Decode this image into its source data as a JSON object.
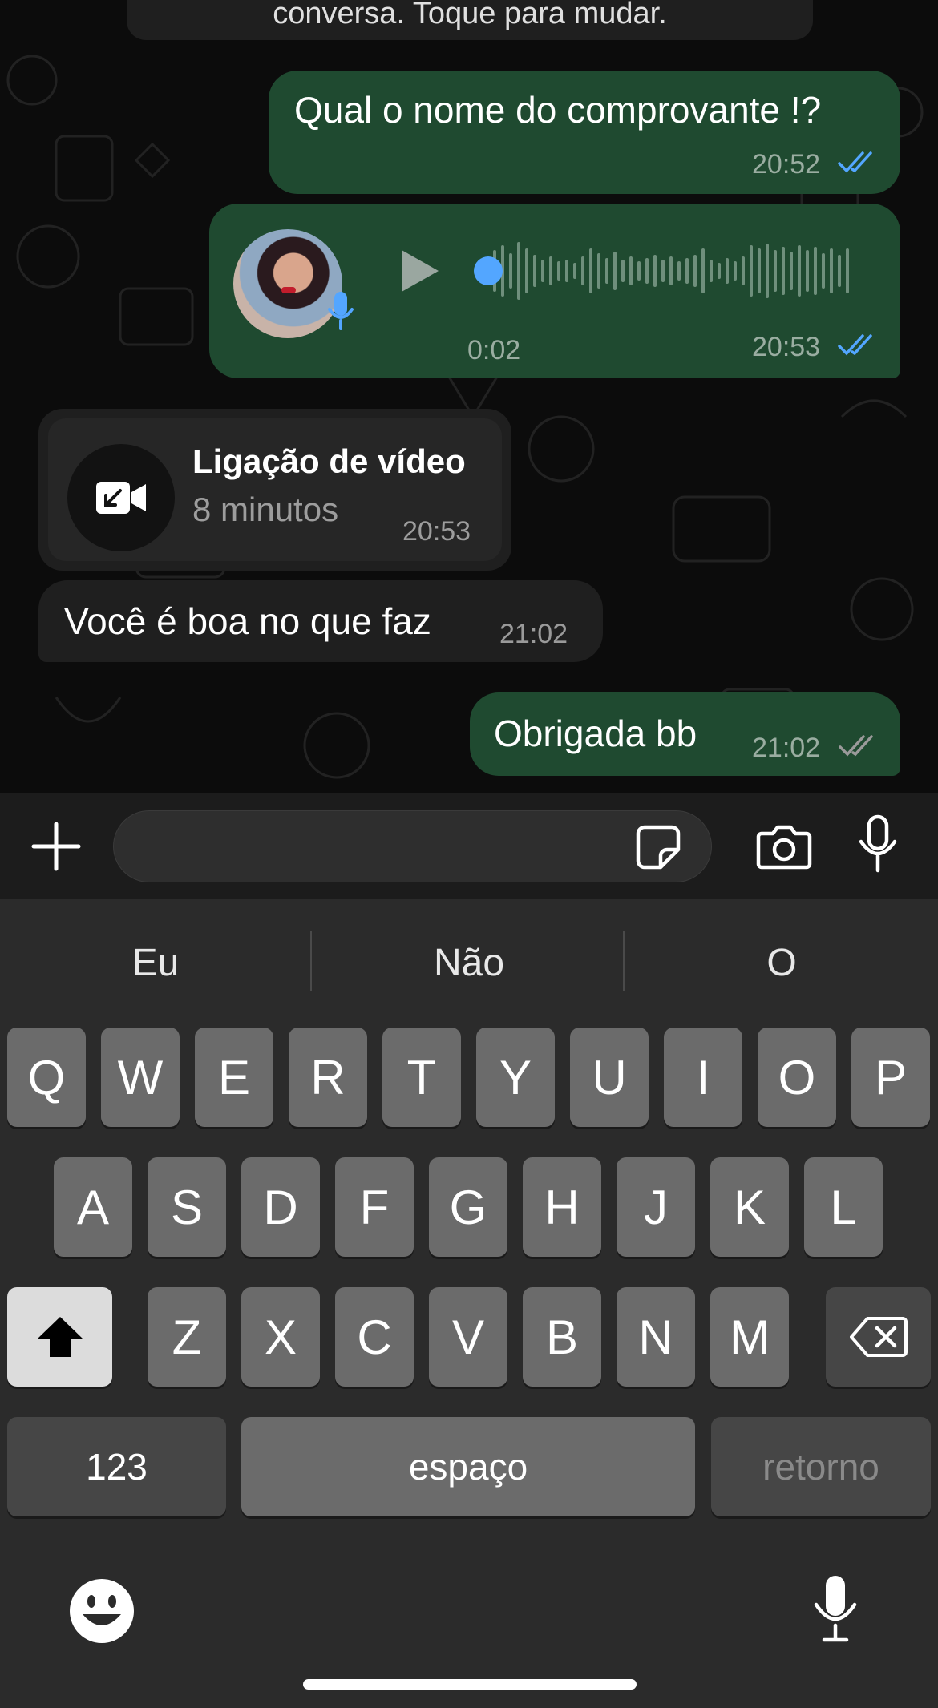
{
  "system_notice": {
    "text": "conversa. Toque para mudar."
  },
  "messages": {
    "m1": {
      "text": "Qual o nome do comprovante !?",
      "time": "20:52"
    },
    "audio": {
      "duration": "0:02",
      "time": "20:53"
    },
    "call": {
      "title": "Ligação de vídeo",
      "subtitle": "8 minutos",
      "time": "20:53"
    },
    "m2": {
      "text": "Você é boa no que faz",
      "time": "21:02"
    },
    "m3": {
      "text": "Obrigada bb",
      "time": "21:02"
    }
  },
  "composer": {
    "placeholder": ""
  },
  "keyboard": {
    "suggestions": [
      "Eu",
      "Não",
      "O"
    ],
    "row1": [
      "Q",
      "W",
      "E",
      "R",
      "T",
      "Y",
      "U",
      "I",
      "O",
      "P"
    ],
    "row2": [
      "A",
      "S",
      "D",
      "F",
      "G",
      "H",
      "J",
      "K",
      "L"
    ],
    "row3": [
      "Z",
      "X",
      "C",
      "V",
      "B",
      "N",
      "M"
    ],
    "numbers_label": "123",
    "space_label": "espaço",
    "return_label": "retorno"
  },
  "colors": {
    "outgoing_bubble": "#1f4a30",
    "incoming_bubble": "#1f1f1f",
    "read_ticks": "#53a6ff",
    "keyboard_bg": "#2b2b2b"
  },
  "icons": {
    "composer": [
      "plus-icon",
      "sticker-icon",
      "camera-icon",
      "microphone-icon"
    ],
    "keyboard": [
      "shift-icon",
      "backspace-icon",
      "emoji-icon",
      "dictation-icon"
    ],
    "message": [
      "play-icon",
      "video-call-icon",
      "double-check-icon"
    ]
  }
}
